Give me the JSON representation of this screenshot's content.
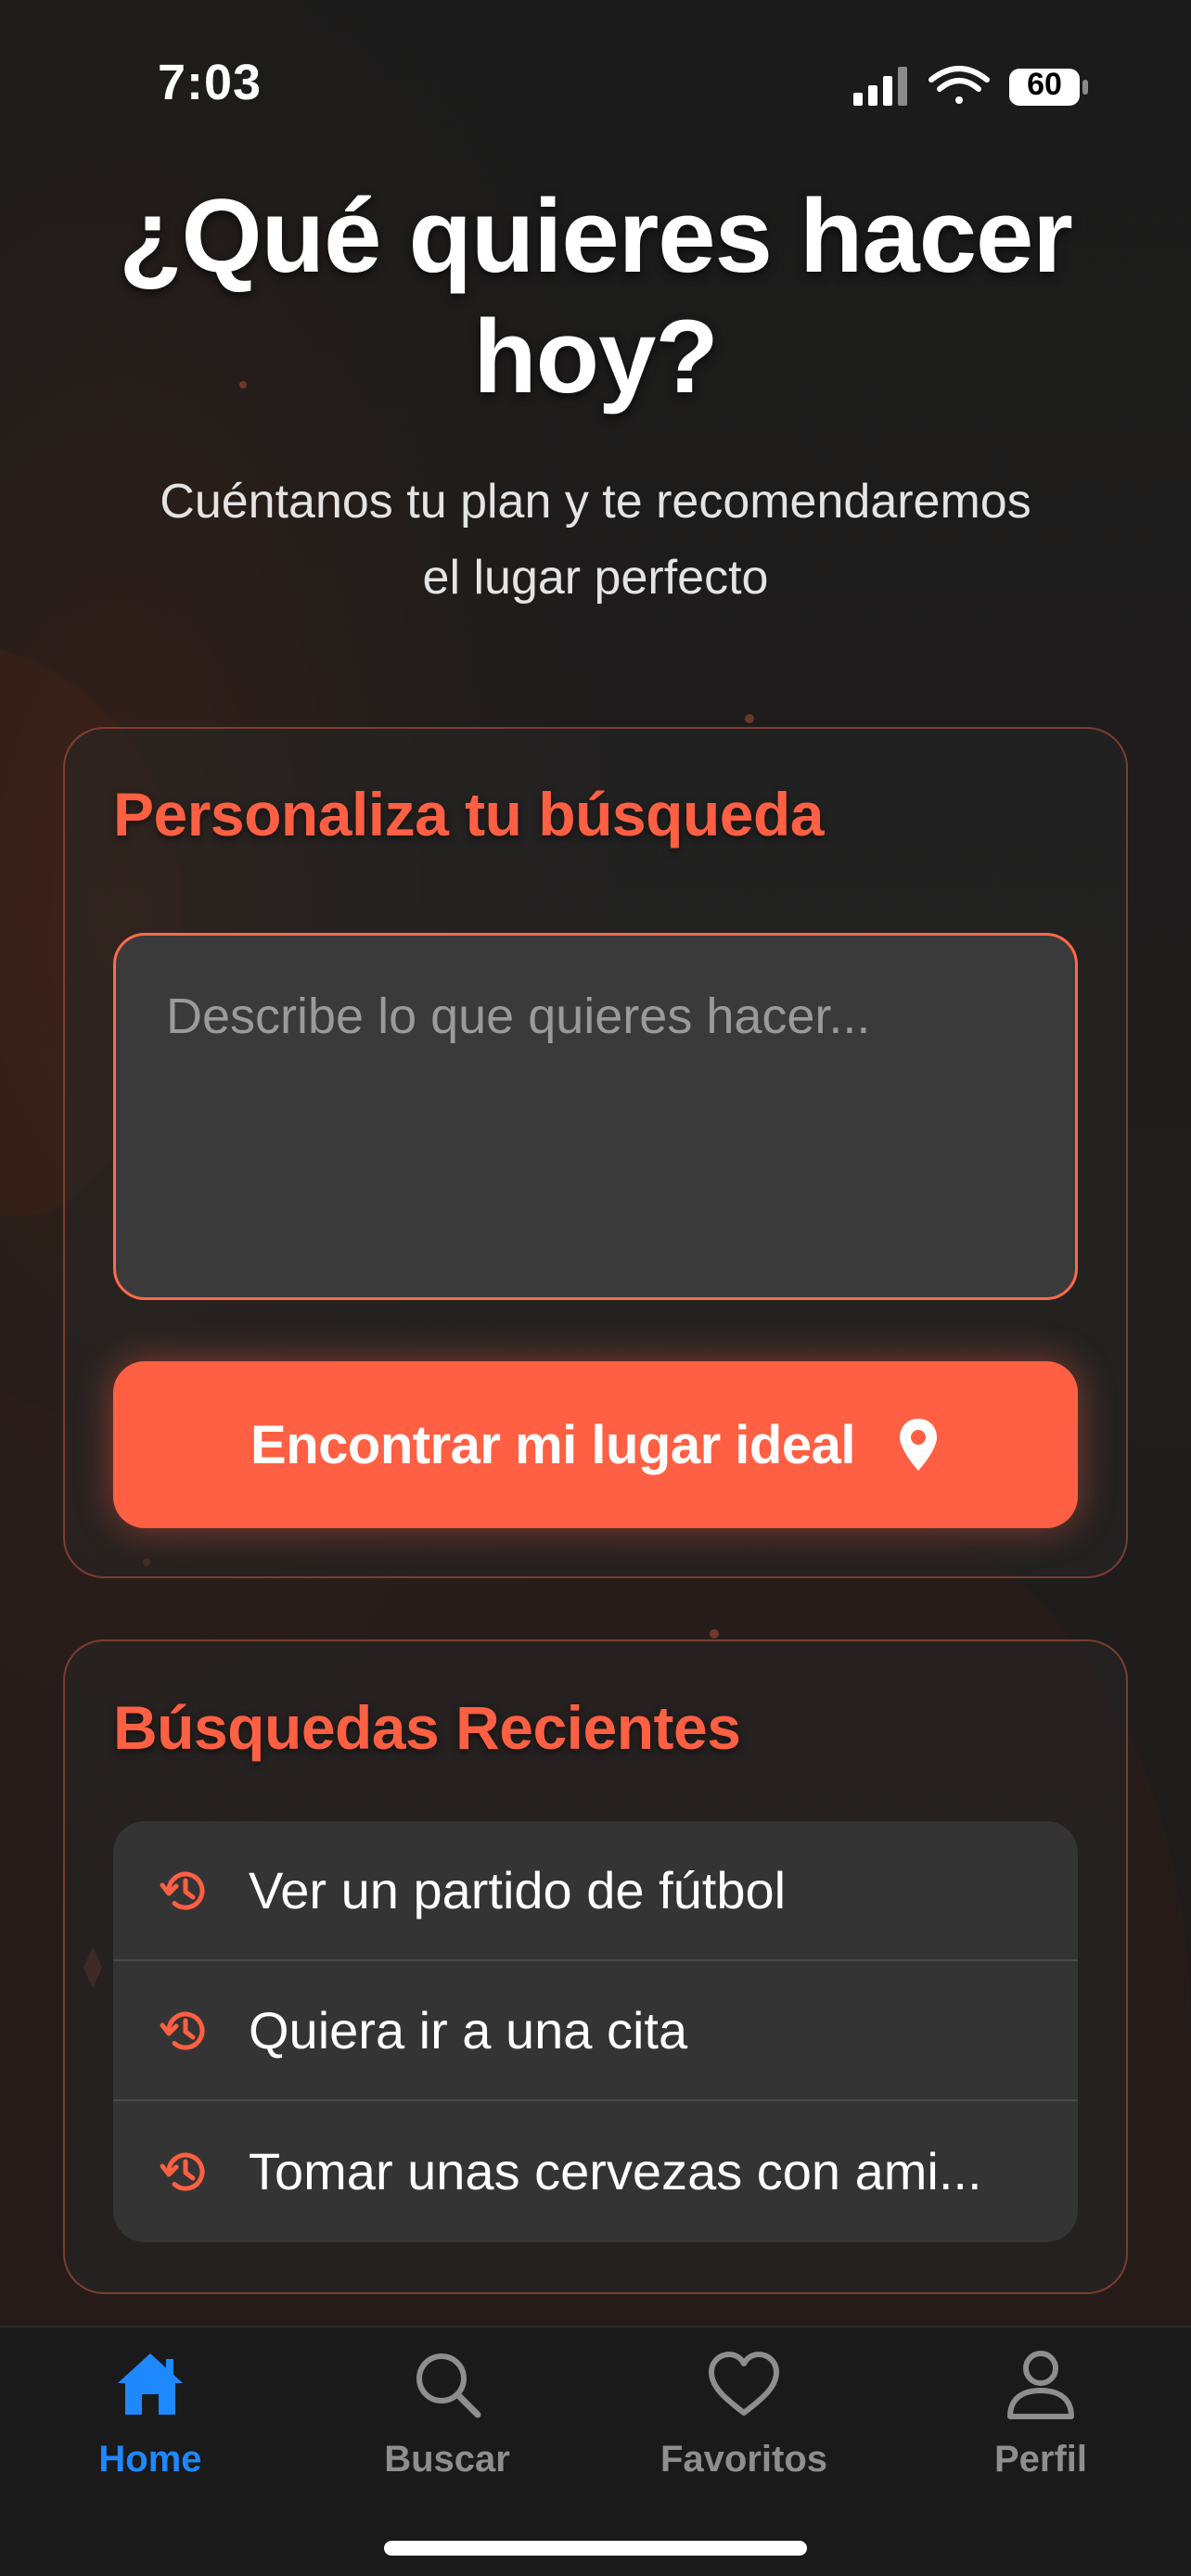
{
  "status_bar": {
    "time": "7:03",
    "battery": "60"
  },
  "header": {
    "title_line1": "¿Qué quieres hacer",
    "title_line2": "hoy?",
    "subtitle_line1": "Cuéntanos tu plan y te recomendaremos",
    "subtitle_line2": "el lugar perfecto"
  },
  "search_card": {
    "title": "Personaliza tu búsqueda",
    "input_placeholder": "Describe lo que quieres hacer...",
    "input_value": "",
    "button_label": "Encontrar mi lugar ideal",
    "button_icon": "map-pin-icon"
  },
  "recent_card": {
    "title": "Búsquedas Recientes",
    "item_icon": "history-icon",
    "items": [
      {
        "text": "Ver un partido de fútbol"
      },
      {
        "text": "Quiera ir a una cita"
      },
      {
        "text": "Tomar unas cervezas con ami..."
      }
    ]
  },
  "tab_bar": {
    "active": "Home",
    "tabs": [
      {
        "label": "Home",
        "icon": "house-icon"
      },
      {
        "label": "Buscar",
        "icon": "search-icon"
      },
      {
        "label": "Favoritos",
        "icon": "heart-icon"
      },
      {
        "label": "Perfil",
        "icon": "person-icon"
      }
    ]
  },
  "colors": {
    "accent": "#ff5f43",
    "tab_active": "#1e88ff",
    "background": "#1c1c1c"
  }
}
